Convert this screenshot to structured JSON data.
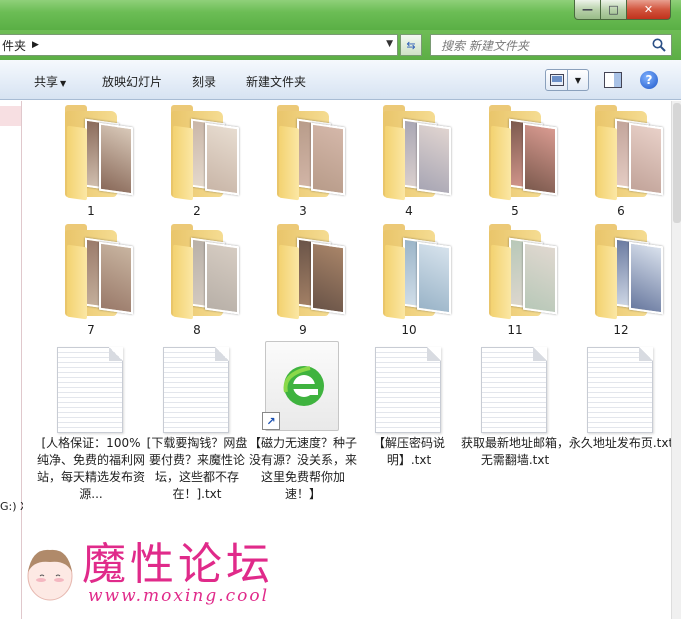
{
  "window": {
    "accent": "#6cbd55",
    "close_color": "#d2553e"
  },
  "title_buttons": {
    "minimize": "—",
    "maximize": "□",
    "close": "✕"
  },
  "address": {
    "path": "件夹",
    "separator": "▶",
    "dropdown": "▼"
  },
  "refresh_icon": "⇆",
  "search": {
    "placeholder": "搜索 新建文件夹"
  },
  "toolbar": {
    "share": "共享",
    "slideshow": "放映幻灯片",
    "burn": "刻录",
    "new_folder": "新建文件夹",
    "view_dropdown": "▼",
    "help": "?"
  },
  "nav_pane": {
    "cut_text": "G:) X"
  },
  "folders": [
    {
      "label": "1"
    },
    {
      "label": "2"
    },
    {
      "label": "3"
    },
    {
      "label": "4"
    },
    {
      "label": "5"
    },
    {
      "label": "6"
    },
    {
      "label": "7"
    },
    {
      "label": "8"
    },
    {
      "label": "9"
    },
    {
      "label": "10"
    },
    {
      "label": "11"
    },
    {
      "label": "12"
    }
  ],
  "files": [
    {
      "label": "[人格保证：100%纯净、免费的福利网站，每天精选发布资源..."
    },
    {
      "label": "[下载要掏钱？网盘要付费？来魔性论坛，这些都不存在！].txt"
    },
    {
      "label": "【磁力无速度？种子没有源？没关系，来这里免费帮你加速！】",
      "shortcut": "↗"
    },
    {
      "label": "【解压密码说明】.txt"
    },
    {
      "label": "获取最新地址邮箱，无需翻墙.txt"
    },
    {
      "label": "永久地址发布页.txt"
    }
  ],
  "watermark": {
    "title": "魔性论坛",
    "url": "www.moxing.cool",
    "color": "#e02a8a"
  }
}
